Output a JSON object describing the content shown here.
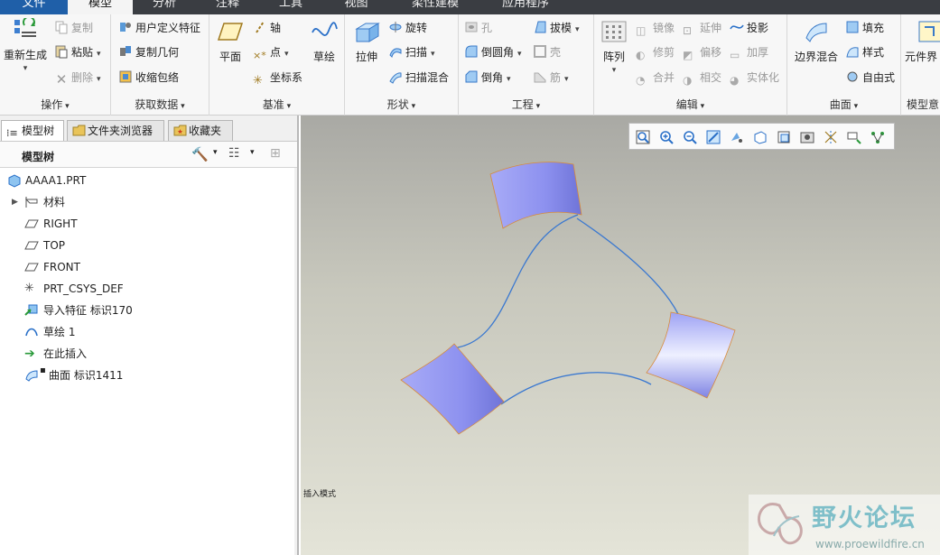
{
  "tabs": [
    "文件",
    "模型",
    "分析",
    "注释",
    "工具",
    "视图",
    "柔性建模",
    "应用程序"
  ],
  "ribbon": {
    "operations": {
      "label": "操作",
      "regen": "重新生成",
      "copy": "复制",
      "paste": "粘贴",
      "delete": "删除"
    },
    "getdata": {
      "label": "获取数据",
      "udf": "用户定义特征",
      "copygeom": "复制几何",
      "shrinkwrap": "收缩包络"
    },
    "datum": {
      "label": "基准",
      "plane": "平面",
      "axis": "轴",
      "point": "点",
      "csys": "坐标系",
      "sketch": "草绘"
    },
    "shapes": {
      "label": "形状",
      "extrude": "拉伸",
      "revolve": "旋转",
      "sweep": "扫描",
      "sweptblend": "扫描混合"
    },
    "engineering": {
      "label": "工程",
      "hole": "孔",
      "draft": "拔模",
      "round": "倒圆角",
      "shell": "壳",
      "chamfer": "倒角",
      "rib": "筋"
    },
    "editing": {
      "label": "编辑",
      "pattern": "阵列",
      "mirror": "镜像",
      "extend": "延伸",
      "project": "投影",
      "trim": "修剪",
      "offset": "偏移",
      "thicken": "加厚",
      "merge": "合并",
      "intersect": "相交",
      "solidify": "实体化"
    },
    "surfaces": {
      "label": "曲面",
      "boundary": "边界混合",
      "fill": "填充",
      "style": "样式",
      "freestyle": "自由式"
    },
    "intent": {
      "label": "模型意",
      "comp": "元件界"
    }
  },
  "panel": {
    "tabs": [
      "模型树",
      "文件夹浏览器",
      "收藏夹"
    ],
    "header": "模型树",
    "items": [
      "AAAA1.PRT",
      "材料",
      "RIGHT",
      "TOP",
      "FRONT",
      "PRT_CSYS_DEF",
      "导入特征 标识170",
      "草绘 1",
      "在此插入",
      "曲面 标识1411"
    ]
  },
  "viewport": {
    "status": "插入模式"
  },
  "watermark": {
    "title": "野火论坛",
    "url": "www.proewildfire.cn"
  },
  "colors": {
    "surface": "#8f93f0",
    "curve": "#3a78d0",
    "ribbon": "#f7f7f7",
    "tabbar": "#3a3d42"
  }
}
